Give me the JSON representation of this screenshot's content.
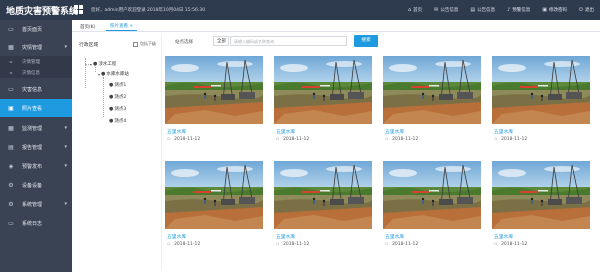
{
  "app": {
    "title": "地质灾害预警系统",
    "welcome": "您好，admin用户欢迎登录    2018年10月04日 15:56:30"
  },
  "topnav": [
    {
      "icon": "home-icon",
      "glyph": "⌂",
      "label": "首页"
    },
    {
      "icon": "message-icon",
      "glyph": "✉",
      "label": "公告信息"
    },
    {
      "icon": "doc-icon",
      "glyph": "▤",
      "label": "公告信息"
    },
    {
      "icon": "bell-icon",
      "glyph": "♪",
      "label": "预警信息"
    },
    {
      "icon": "lock-icon",
      "glyph": "▣",
      "label": "修改密码"
    },
    {
      "icon": "exit-icon",
      "glyph": "⏻",
      "label": "退出"
    }
  ],
  "sidebar": [
    {
      "label": "首页面页",
      "glyph": "▭",
      "icon": "home-icon",
      "arrow": ""
    },
    {
      "label": "灾情管理",
      "glyph": "▦",
      "icon": "folder-icon",
      "arrow": "▾"
    },
    {
      "label": "灾情管理",
      "glyph": "▫",
      "icon": "dot-icon",
      "arrow": "",
      "sub": true
    },
    {
      "label": "灾情信息",
      "glyph": "▫",
      "icon": "dot-icon",
      "arrow": "",
      "sub": true
    },
    {
      "label": "灾害信息",
      "glyph": "▭",
      "icon": "list-icon",
      "arrow": ""
    },
    {
      "label": "照片查看",
      "glyph": "▣",
      "icon": "photo-icon",
      "arrow": "",
      "active": true
    },
    {
      "label": "监测管理",
      "glyph": "▦",
      "icon": "monitor-icon",
      "arrow": "▾"
    },
    {
      "label": "报告管理",
      "glyph": "▤",
      "icon": "report-icon",
      "arrow": "▾"
    },
    {
      "label": "预警发布",
      "glyph": "◈",
      "icon": "alert-icon",
      "arrow": "▾"
    },
    {
      "label": "设备设备",
      "glyph": "⚙",
      "icon": "device-icon",
      "arrow": ""
    },
    {
      "label": "系统管理",
      "glyph": "⚙",
      "icon": "settings-icon",
      "arrow": "▾"
    },
    {
      "label": "系统日志",
      "glyph": "▭",
      "icon": "log-icon",
      "arrow": ""
    }
  ],
  "tabs": [
    {
      "label": "首页(K)"
    },
    {
      "label": "照片查看  ×"
    }
  ],
  "tree": {
    "title": "行政区域",
    "check_label": "包括下级",
    "nodes": [
      {
        "label": "涉水工程",
        "level": 0
      },
      {
        "label": "水库水库站",
        "level": 1
      },
      {
        "label": "测点1",
        "level": 2
      },
      {
        "label": "测点2",
        "level": 2
      },
      {
        "label": "测点3",
        "level": 2
      },
      {
        "label": "测点4",
        "level": 2
      }
    ]
  },
  "filter": {
    "label": "站点选择",
    "select_value": "全部",
    "placeholder": "请输入编码或名称查询",
    "search_label": "搜索"
  },
  "photos": [
    {
      "name": "五里水库",
      "date": "2018-11-12"
    },
    {
      "name": "五里水库",
      "date": "2018-11-12"
    },
    {
      "name": "五里水库",
      "date": "2018-11-12"
    },
    {
      "name": "五里水库",
      "date": "2018-11-12"
    },
    {
      "name": "五里水库",
      "date": "2018-11-12"
    },
    {
      "name": "五里水库",
      "date": "2018-11-12"
    },
    {
      "name": "五里水库",
      "date": "2018-11-12"
    },
    {
      "name": "五里水库",
      "date": "2018-11-12"
    }
  ],
  "colors": {
    "sidebar": "#3a4354",
    "topbar": "#2e3a4e",
    "accent": "#1e9ae0"
  }
}
